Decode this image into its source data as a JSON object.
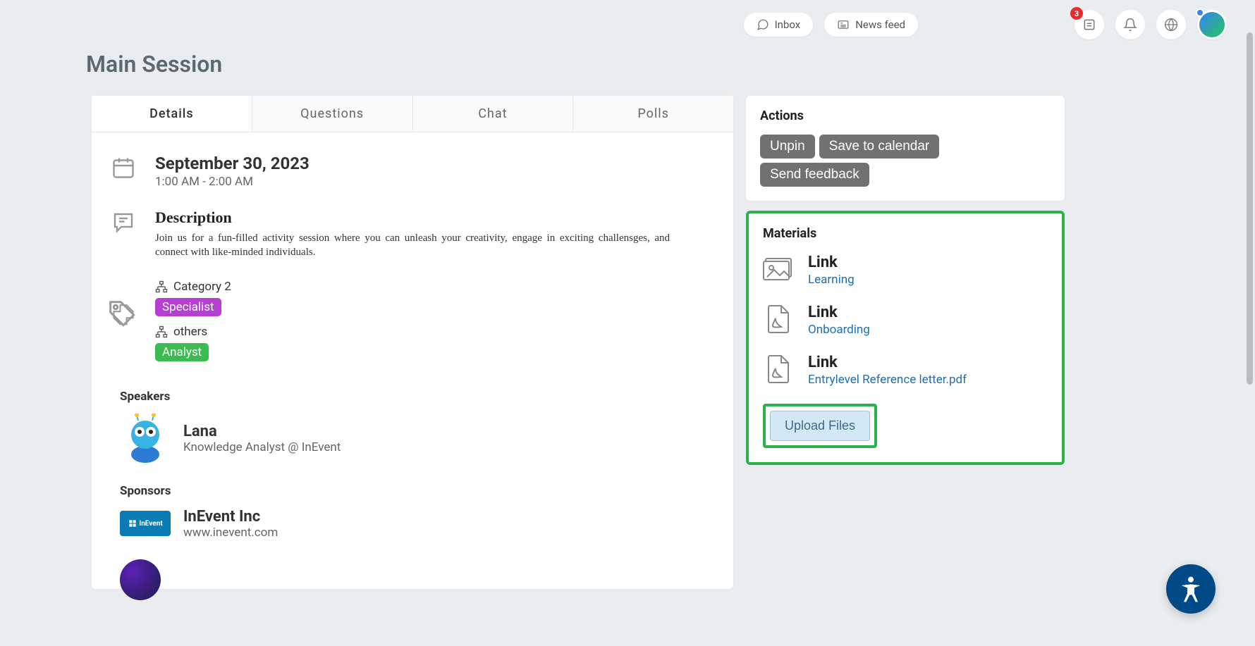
{
  "topbar": {
    "inbox": "Inbox",
    "newsfeed": "News feed",
    "badge_count": "3"
  },
  "page": {
    "title": "Main Session"
  },
  "tabs": {
    "details": "Details",
    "questions": "Questions",
    "chat": "Chat",
    "polls": "Polls",
    "active": "details"
  },
  "details": {
    "date": "September 30, 2023",
    "time": "1:00 AM - 2:00 AM",
    "description_heading": "Description",
    "description_body": "Join us for a fun-filled activity session where you can unleash your creativity, engage in exciting challensges, and connect with like-minded individuals.",
    "categories": [
      {
        "label": "Category 2",
        "tag": "Specialist",
        "tag_class": "tag-specialist"
      },
      {
        "label": "others",
        "tag": "Analyst",
        "tag_class": "tag-analyst"
      }
    ]
  },
  "speakers": {
    "heading": "Speakers",
    "items": [
      {
        "name": "Lana",
        "role": "Knowledge Analyst @ InEvent"
      }
    ]
  },
  "sponsors": {
    "heading": "Sponsors",
    "items": [
      {
        "name": "InEvent Inc",
        "url": "www.inevent.com",
        "logo_text": "InEvent"
      }
    ]
  },
  "actions": {
    "heading": "Actions",
    "unpin": "Unpin",
    "save_calendar": "Save to calendar",
    "send_feedback": "Send feedback"
  },
  "materials": {
    "heading": "Materials",
    "link_label": "Link",
    "items": [
      {
        "type": "image",
        "name": "Learning"
      },
      {
        "type": "pdf",
        "name": "Onboarding"
      },
      {
        "type": "pdf",
        "name": "Entrylevel Reference letter.pdf"
      }
    ],
    "upload_label": "Upload Files"
  }
}
